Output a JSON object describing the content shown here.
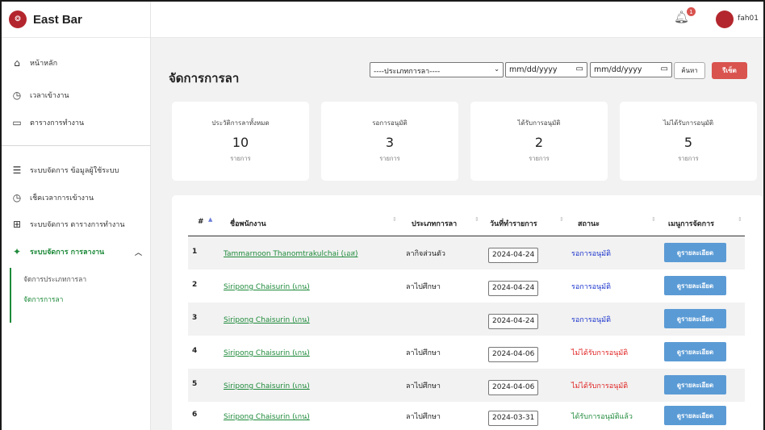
{
  "app": {
    "title": "East Bar"
  },
  "user": {
    "name": "fah01",
    "notifications": "1"
  },
  "sidebar": {
    "items": [
      {
        "label": "หน้าหลัก"
      },
      {
        "label": "เวลาเข้างาน"
      },
      {
        "label": "ตารางการทำงาน"
      },
      {
        "label": "ระบบจัดการ ข้อมูลผู้ใช้ระบบ"
      },
      {
        "label": "เช็คเวลาการเข้างาน"
      },
      {
        "label": "ระบบจัดการ ตารางการทำงาน"
      },
      {
        "label": "ระบบจัดการ การลางาน"
      }
    ],
    "sub": [
      {
        "label": "จัดการประเภทการลา"
      },
      {
        "label": "จัดการการลา"
      }
    ]
  },
  "page": {
    "title": "จัดการการลา"
  },
  "filters": {
    "type_select": "----ประเภทการลา----",
    "date_from": "mm/dd/yyyy",
    "date_to": "mm/dd/yyyy",
    "search": "ค้นหา",
    "reset": "รีเซ็ต"
  },
  "stats": [
    {
      "label": "ประวัติการลาทั้งหมด",
      "value": "10",
      "unit": "รายการ"
    },
    {
      "label": "รอการอนุมัติ",
      "value": "3",
      "unit": "รายการ"
    },
    {
      "label": "ได้รับการอนุมัติ",
      "value": "2",
      "unit": "รายการ"
    },
    {
      "label": "ไม่ได้รับการอนุมัติ",
      "value": "5",
      "unit": "รายการ"
    }
  ],
  "table": {
    "headers": [
      "#",
      "ชื่อพนักงาน",
      "ประเภทการลา",
      "วันที่ทำรายการ",
      "สถานะ",
      "เมนูการจัดการ"
    ],
    "rows": [
      {
        "idx": "1",
        "name": "Tammarnoon Thanomtrakulchai (เอส)",
        "type": "ลากิจส่วนตัว",
        "date": "2024-04-24",
        "status": "รอการอนุมัติ",
        "action": "ดูรายละเอียด"
      },
      {
        "idx": "2",
        "name": "Siripong Chaisurin (เกน)",
        "type": "ลาไปศึกษา",
        "date": "2024-04-24",
        "status": "รอการอนุมัติ",
        "action": "ดูรายละเอียด"
      },
      {
        "idx": "3",
        "name": "Siripong Chaisurin (เกน)",
        "type": "",
        "date": "2024-04-24",
        "status": "รอการอนุมัติ",
        "action": "ดูรายละเอียด"
      },
      {
        "idx": "4",
        "name": "Siripong Chaisurin (เกน)",
        "type": "ลาไปศึกษา",
        "date": "2024-04-06",
        "status": "ไม่ได้รับการอนุมัติ",
        "action": "ดูรายละเอียด"
      },
      {
        "idx": "5",
        "name": "Siripong Chaisurin (เกน)",
        "type": "ลาไปศึกษา",
        "date": "2024-04-06",
        "status": "ไม่ได้รับการอนุมัติ",
        "action": "ดูรายละเอียด"
      },
      {
        "idx": "6",
        "name": "Siripong Chaisurin (เกน)",
        "type": "ลาไปศึกษา",
        "date": "2024-03-31",
        "status": "ได้รับการอนุมัติแล้ว",
        "action": "ดูรายละเอียด"
      }
    ]
  },
  "colors": {
    "accent": "#1e8a3a",
    "pending": "#1a33cc",
    "rejected": "#e02020",
    "approved": "#1e8a3a",
    "button": "#5b9bd5",
    "danger": "#d9534f"
  }
}
